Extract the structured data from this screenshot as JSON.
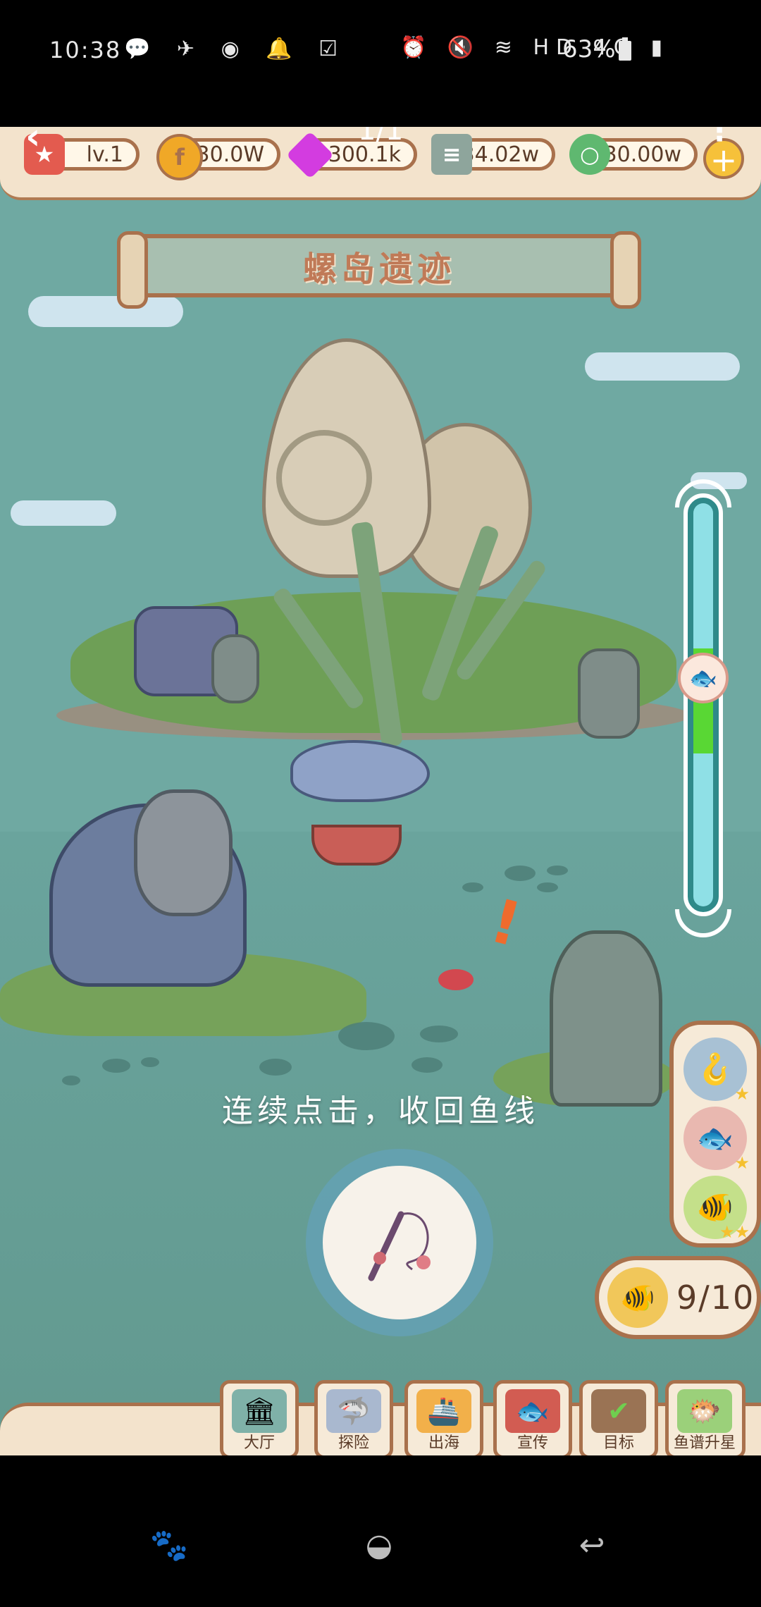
{
  "status_bar": {
    "time": "10:38",
    "battery": "63%",
    "left_icons": "💬 ✈ ◉ 🔔 ☑",
    "right_icons": "⏰ 🔇 ≋ HD 4G ▮"
  },
  "header": {
    "back_icon": "‹",
    "page_indicator": "1/1",
    "more_icon": "⋮",
    "level": "lv.1",
    "coins": "30.0W",
    "gems": "300.1k",
    "books": "234.02w",
    "rings": "30.00w",
    "plus": "+"
  },
  "scene": {
    "title": "螺岛遗迹",
    "instruction": "连续点击，收回鱼线",
    "alert": "!"
  },
  "gauge": {
    "zone_start": 0.36,
    "zone_end": 0.62,
    "marker_position": 0.43,
    "accent": "#59d734"
  },
  "fish_panel": {
    "slots": [
      {
        "icon": "🪝",
        "stars": "★"
      },
      {
        "icon": "🐟",
        "stars": "★"
      },
      {
        "icon": "🐠",
        "stars": "★★"
      }
    ]
  },
  "catch_counter": {
    "icon": "🐠",
    "text": "9/10"
  },
  "menu": [
    {
      "label": "大厅",
      "icon": "🏛"
    },
    {
      "label": "探险",
      "icon": "🦈"
    },
    {
      "label": "出海",
      "icon": "🚢"
    },
    {
      "label": "宣传",
      "icon": "🐟"
    },
    {
      "label": "目标",
      "icon": "✔"
    },
    {
      "label": "鱼谱升星",
      "icon": "🐡"
    }
  ],
  "system_nav": {
    "left": "🐾",
    "center": "◒",
    "right": "↩"
  }
}
